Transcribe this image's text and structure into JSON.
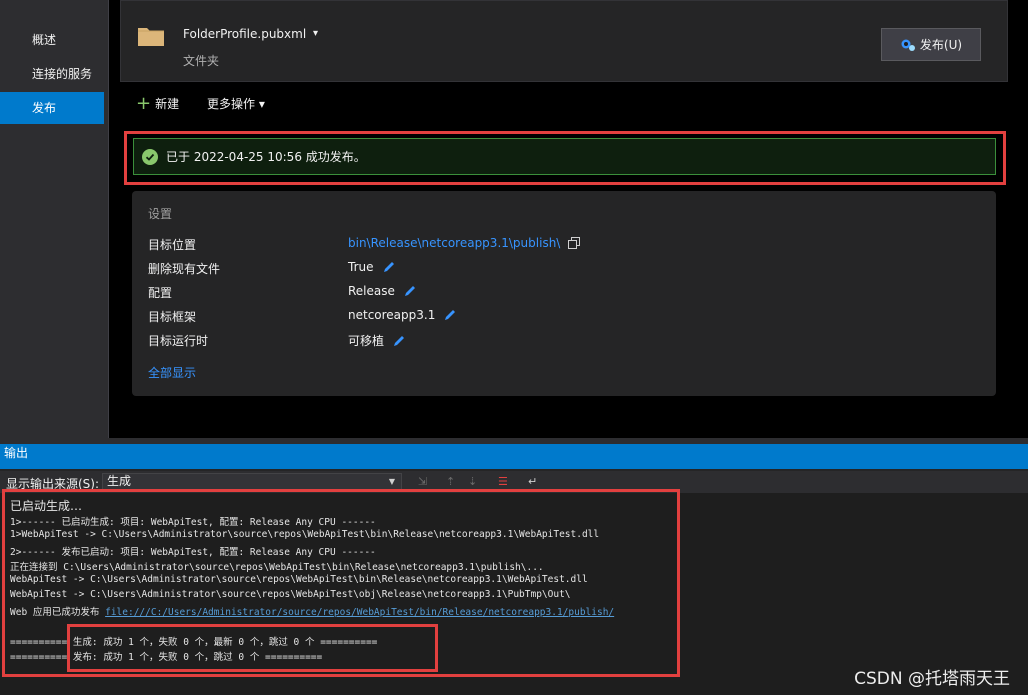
{
  "sidebar": {
    "items": [
      {
        "label": "概述"
      },
      {
        "label": "连接的服务"
      },
      {
        "label": "发布"
      }
    ]
  },
  "profile": {
    "name": "FolderProfile.pubxml",
    "type": "文件夹",
    "publish_label": "发布(U)"
  },
  "actions": {
    "new_label": "新建",
    "more_label": "更多操作 ▾"
  },
  "status": {
    "message": "已于 2022-04-25 10:56 成功发布。"
  },
  "settings": {
    "title": "设置",
    "rows": [
      {
        "label": "目标位置",
        "value": "bin\\Release\\netcoreapp3.1\\publish\\"
      },
      {
        "label": "删除现有文件",
        "value": "True"
      },
      {
        "label": "配置",
        "value": "Release"
      },
      {
        "label": "目标框架",
        "value": "netcoreapp3.1"
      },
      {
        "label": "目标运行时",
        "value": "可移植"
      }
    ],
    "show_all": "全部显示"
  },
  "output": {
    "title": "输出",
    "source_label": "显示输出来源(S):",
    "source_value": "生成",
    "lines": [
      "已启动生成…",
      "1>------ 已启动生成: 项目: WebApiTest, 配置: Release Any CPU ------",
      "1>WebApiTest -> C:\\Users\\Administrator\\source\\repos\\WebApiTest\\bin\\Release\\netcoreapp3.1\\WebApiTest.dll",
      "2>------ 发布已启动: 项目: WebApiTest, 配置: Release Any CPU ------",
      "正在连接到 C:\\Users\\Administrator\\source\\repos\\WebApiTest\\bin\\Release\\netcoreapp3.1\\publish\\...",
      "WebApiTest -> C:\\Users\\Administrator\\source\\repos\\WebApiTest\\bin\\Release\\netcoreapp3.1\\WebApiTest.dll",
      "WebApiTest -> C:\\Users\\Administrator\\source\\repos\\WebApiTest\\obj\\Release\\netcoreapp3.1\\PubTmp\\Out\\",
      "Web 应用已成功发布 "
    ],
    "publish_link": "file:///C:/Users/Administrator/source/repos/WebApiTest/bin/Release/netcoreapp3.1/publish/",
    "summary": [
      "========== 生成: 成功 1 个，失败 0 个，最新 0 个，跳过 0 个 ==========",
      "========== 发布: 成功 1 个，失败 0 个，跳过 0 个 =========="
    ]
  },
  "watermark": "CSDN @托塔雨天王",
  "colors": {
    "accent": "#007acc",
    "highlight": "#e2403f",
    "success": "#89c76c",
    "link": "#3794ff"
  }
}
